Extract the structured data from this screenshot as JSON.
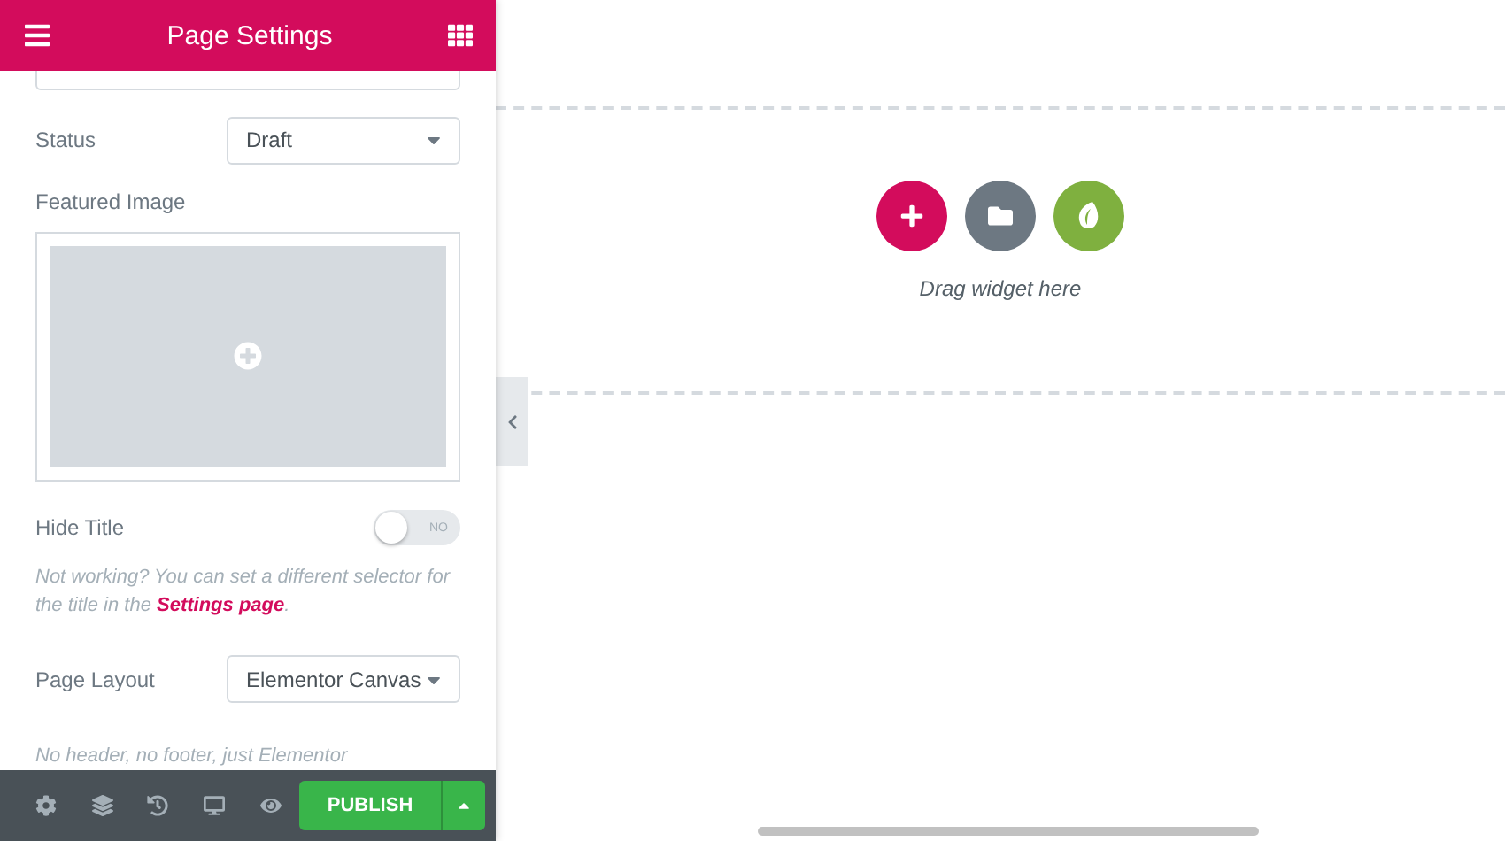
{
  "panel": {
    "title": "Page Settings"
  },
  "fields": [
    {
      "kind": "select",
      "label": "Status",
      "value": "Draft"
    },
    {
      "kind": "image",
      "label": "Featured Image"
    },
    {
      "kind": "toggle",
      "label": "Hide Title",
      "on": false,
      "toggle_text": "NO",
      "note": "Not working? You can set a different selector for the title in the ",
      "link": "Settings page",
      "note_end": "."
    },
    {
      "kind": "select",
      "label": "Page Layout",
      "value": "Elementor Canvas",
      "note": "No header, no footer, just Elementor"
    }
  ],
  "footer": {
    "publish": "PUBLISH"
  },
  "canvas": {
    "hint": "Drag widget here"
  }
}
